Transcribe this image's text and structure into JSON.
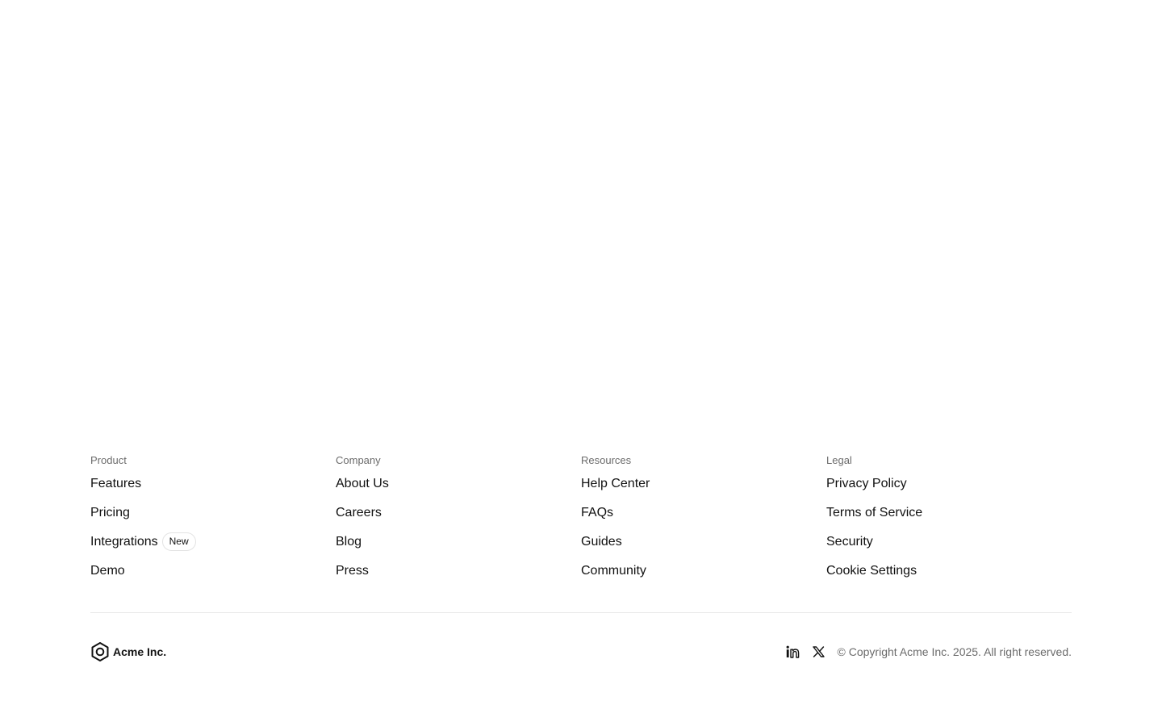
{
  "footer": {
    "columns": [
      {
        "heading": "Product",
        "links": [
          {
            "label": "Features"
          },
          {
            "label": "Pricing"
          },
          {
            "label": "Integrations",
            "badge": "New"
          },
          {
            "label": "Demo"
          }
        ]
      },
      {
        "heading": "Company",
        "links": [
          {
            "label": "About Us"
          },
          {
            "label": "Careers"
          },
          {
            "label": "Blog"
          },
          {
            "label": "Press"
          }
        ]
      },
      {
        "heading": "Resources",
        "links": [
          {
            "label": "Help Center"
          },
          {
            "label": "FAQs"
          },
          {
            "label": "Guides"
          },
          {
            "label": "Community"
          }
        ]
      },
      {
        "heading": "Legal",
        "links": [
          {
            "label": "Privacy Policy"
          },
          {
            "label": "Terms of Service"
          },
          {
            "label": "Security"
          },
          {
            "label": "Cookie Settings"
          }
        ]
      }
    ],
    "brand": {
      "name": "Acme Inc.",
      "logo_icon": "hexagon-logo-icon"
    },
    "social": [
      {
        "icon": "linkedin-icon"
      },
      {
        "icon": "x-icon"
      }
    ],
    "copyright": "© Copyright Acme Inc. 2025. All right reserved."
  },
  "colors": {
    "text": "#111111",
    "muted": "#6b6b6b",
    "divider": "#e8e8e8",
    "background": "#ffffff"
  }
}
